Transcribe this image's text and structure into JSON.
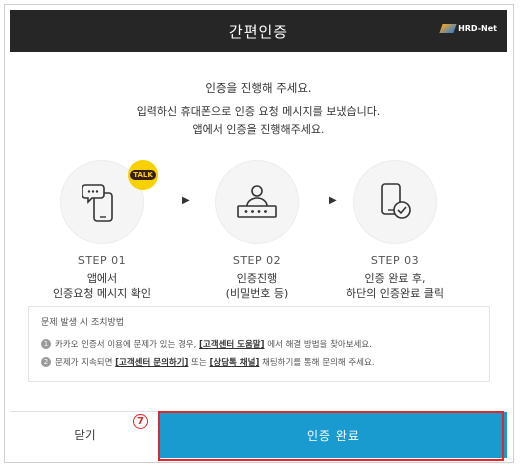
{
  "header": {
    "title": "간편인증",
    "logo_text": "HRD-Net"
  },
  "intro": {
    "line1": "인증을 진행해 주세요.",
    "line2": "입력하신 휴대폰으로 인증 요청 메시지를 보냈습니다.",
    "line3": "앱에서 인증을 진행해주세요."
  },
  "badge": {
    "label": "TALK"
  },
  "steps": [
    {
      "no": "STEP 01",
      "desc1": "앱에서",
      "desc2": "인증요청 메시지 확인",
      "icon": "phone-chat-icon"
    },
    {
      "no": "STEP 02",
      "desc1": "인증진행",
      "desc2": "(비밀번호 등)",
      "icon": "user-password-icon"
    },
    {
      "no": "STEP 03",
      "desc1": "인증 완료 후,",
      "desc2": "하단의 인증완료 클릭",
      "icon": "phone-check-icon"
    }
  ],
  "notice": {
    "title": "문제 발생 시 조치방법",
    "item1": {
      "num": "1",
      "pre": "카카오 인증서 이용에 문제가 있는 경우,",
      "link": "[고객센터 도움말]",
      "post": "에서 해결 방법을 찾아보세요."
    },
    "item2": {
      "num": "2",
      "pre": "문제가 지속되면",
      "link1": "[고객센터 문의하기]",
      "mid": "또는",
      "link2": "[상담톡 채널]",
      "post": "채팅하기를 통해 문의해 주세요."
    }
  },
  "footer": {
    "close_label": "닫기",
    "done_label": "인증 완료"
  },
  "marker": {
    "label": "7"
  },
  "colors": {
    "header_bg": "#262626",
    "done_bg": "#1a9bd0",
    "talk_yellow": "#f7d200",
    "highlight": "#e3262a"
  }
}
